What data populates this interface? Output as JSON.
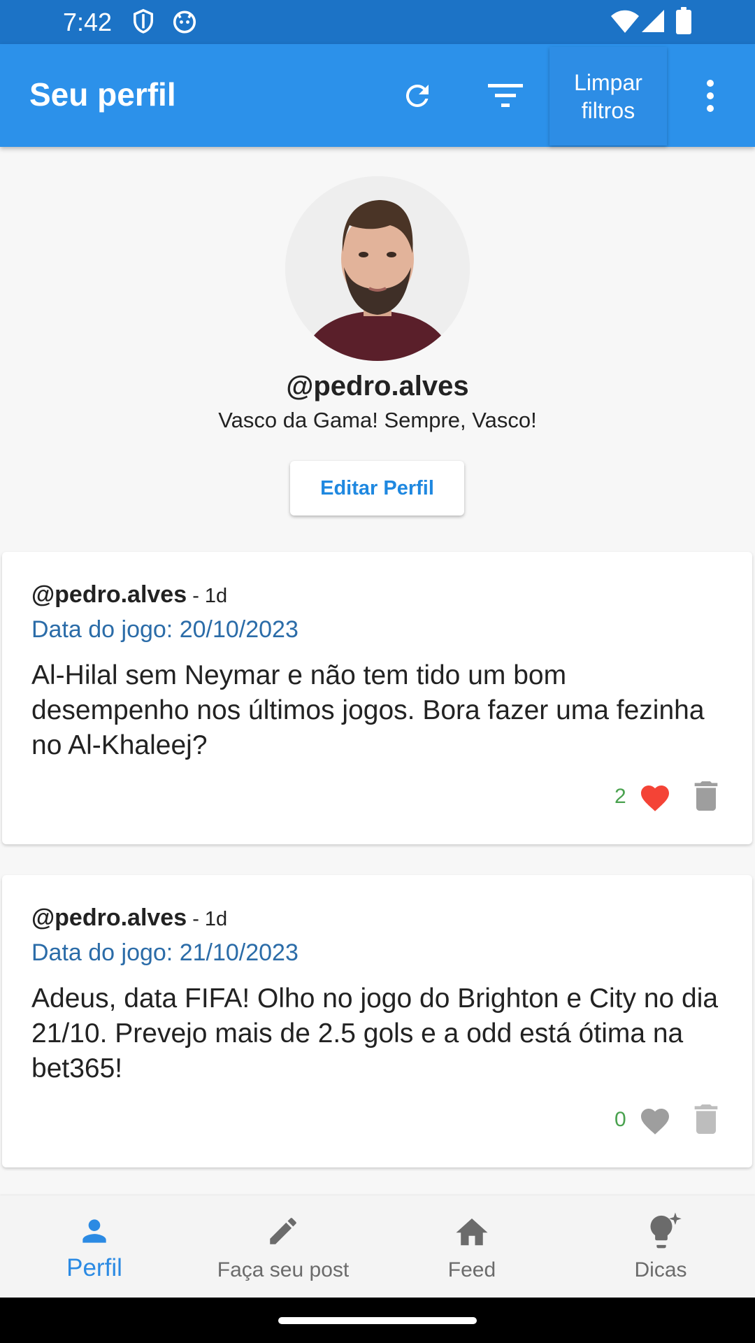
{
  "status_bar": {
    "time": "7:42"
  },
  "app_bar": {
    "title": "Seu perfil",
    "clear_filters_label": "Limpar filtros"
  },
  "profile": {
    "username": "@pedro.alves",
    "bio": "Vasco da Gama! Sempre, Vasco!",
    "edit_button_label": "Editar Perfil"
  },
  "posts": [
    {
      "author": "@pedro.alves",
      "age": " - 1d",
      "game_date": "Data do jogo: 20/10/2023",
      "text": "Al-Hilal sem Neymar e não tem tido um bom desempenho nos últimos jogos. Bora fazer uma fezinha no Al-Khaleej?",
      "likes": "2",
      "liked": true
    },
    {
      "author": "@pedro.alves",
      "age": " - 1d",
      "game_date": "Data do jogo: 21/10/2023",
      "text": "Adeus, data FIFA! Olho no jogo do Brighton e City no dia 21/10. Prevejo mais de 2.5 gols e a odd está ótima na bet365!",
      "likes": "0",
      "liked": false
    }
  ],
  "bottom_nav": {
    "items": [
      {
        "label": "Perfil",
        "icon": "person-icon",
        "active": true
      },
      {
        "label": "Faça seu post",
        "icon": "pencil-icon",
        "active": false
      },
      {
        "label": "Feed",
        "icon": "home-icon",
        "active": false
      },
      {
        "label": "Dicas",
        "icon": "lightbulb-icon",
        "active": false
      }
    ]
  },
  "colors": {
    "status_bar": "#1c73c6",
    "app_bar": "#2c91ea",
    "accent": "#2b8ae3",
    "like_active": "#f44336",
    "like_inactive": "#9e9e9e",
    "like_count": "#4aa24f"
  }
}
